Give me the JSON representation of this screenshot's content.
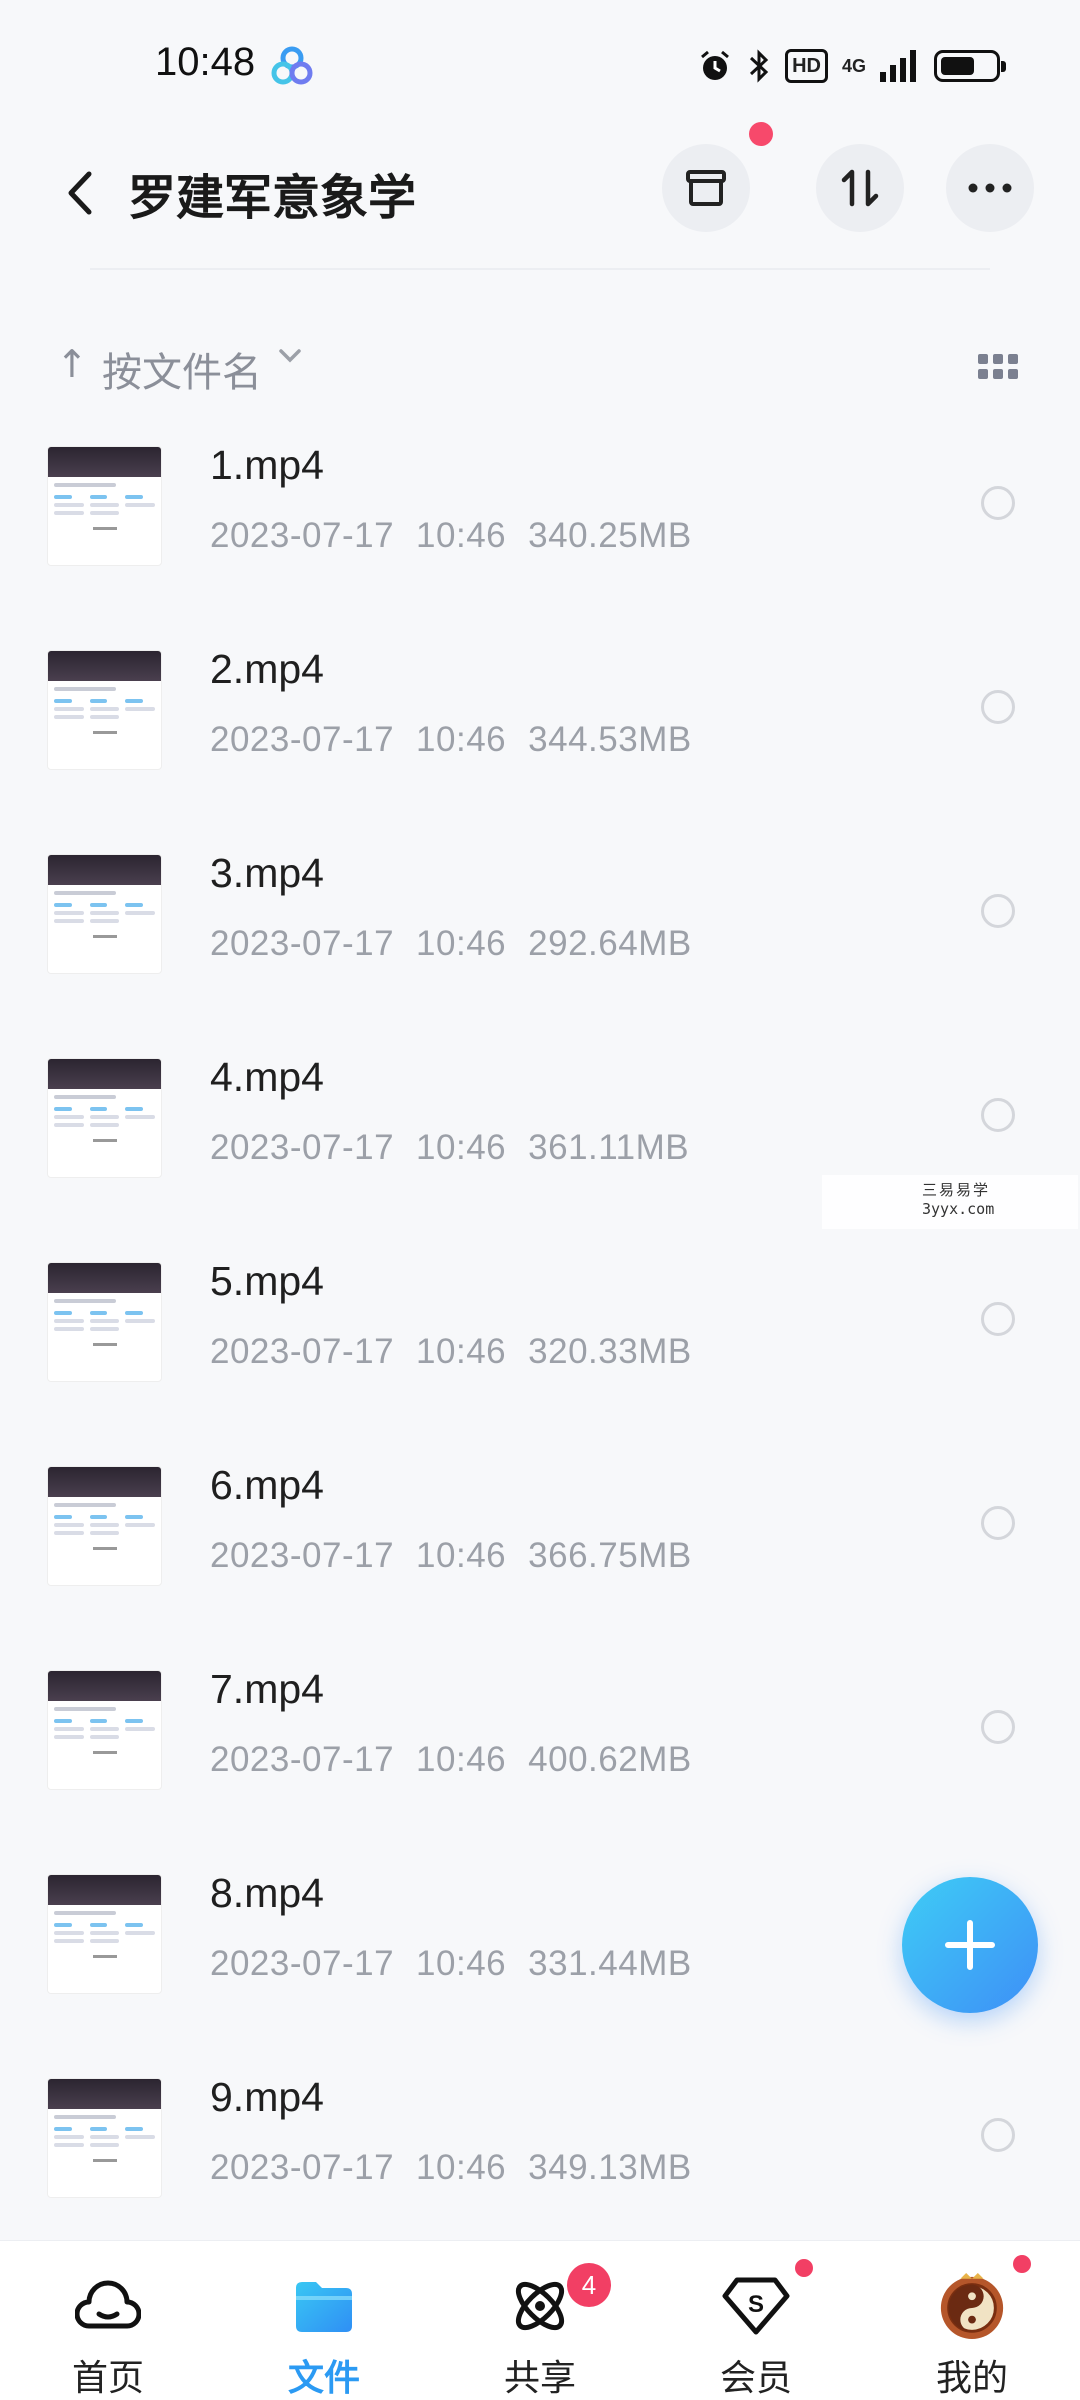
{
  "status_bar": {
    "time": "10:48",
    "hd_label": "HD",
    "network_label": "4G",
    "battery_level": 0.55,
    "icons": [
      "app-logo-icon",
      "alarm-icon",
      "bluetooth-icon",
      "hd-icon",
      "signal-icon",
      "battery-icon"
    ]
  },
  "header": {
    "title": "罗建军意象学",
    "back_icon": "chevron-left-icon",
    "actions": [
      {
        "name": "archive-icon",
        "has_dot": true
      },
      {
        "name": "transfer-icon"
      },
      {
        "name": "more-icon"
      }
    ]
  },
  "sort": {
    "direction_icon": "↑",
    "label": "按文件名",
    "view_icon": "grid-view-icon"
  },
  "files": [
    {
      "name": "1.mp4",
      "date": "2023-07-17",
      "time": "10:46",
      "size": "340.25MB"
    },
    {
      "name": "2.mp4",
      "date": "2023-07-17",
      "time": "10:46",
      "size": "344.53MB"
    },
    {
      "name": "3.mp4",
      "date": "2023-07-17",
      "time": "10:46",
      "size": "292.64MB"
    },
    {
      "name": "4.mp4",
      "date": "2023-07-17",
      "time": "10:46",
      "size": "361.11MB"
    },
    {
      "name": "5.mp4",
      "date": "2023-07-17",
      "time": "10:46",
      "size": "320.33MB"
    },
    {
      "name": "6.mp4",
      "date": "2023-07-17",
      "time": "10:46",
      "size": "366.75MB"
    },
    {
      "name": "7.mp4",
      "date": "2023-07-17",
      "time": "10:46",
      "size": "400.62MB"
    },
    {
      "name": "8.mp4",
      "date": "2023-07-17",
      "time": "10:46",
      "size": "331.44MB"
    },
    {
      "name": "9.mp4",
      "date": "2023-07-17",
      "time": "10:46",
      "size": "349.13MB"
    }
  ],
  "watermark": {
    "line1": "三易易学",
    "line2": "3yyx.com"
  },
  "fab": {
    "icon": "plus-icon"
  },
  "bottom_nav": {
    "items": [
      {
        "label": "首页",
        "icon": "home-cloud-icon"
      },
      {
        "label": "文件",
        "icon": "folder-icon",
        "active": true
      },
      {
        "label": "共享",
        "icon": "share-orbit-icon",
        "badge": "4"
      },
      {
        "label": "会员",
        "icon": "vip-diamond-icon",
        "dot": true
      },
      {
        "label": "我的",
        "icon": "avatar-icon",
        "dot": true
      }
    ]
  },
  "colors": {
    "accent": "#2b9af3",
    "badge": "#f23f64",
    "meta_text": "#9ca0a8",
    "background": "#f7f8fa"
  }
}
